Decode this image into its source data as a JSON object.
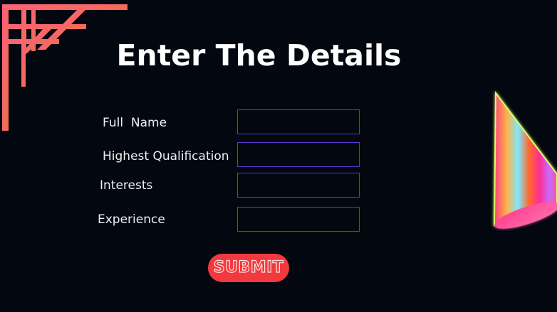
{
  "form": {
    "title": "Enter The Details",
    "fields": [
      {
        "label": "Full  Name",
        "value": ""
      },
      {
        "label": "Highest Qualification",
        "value": ""
      },
      {
        "label": "Interests",
        "value": ""
      },
      {
        "label": "Experience",
        "value": ""
      }
    ],
    "submit_label": "SUBMIT"
  },
  "colors": {
    "background": "#03070f",
    "input_border": "#6236d6",
    "submit_button": "#f1393f",
    "corner_decoration_from": "#ff5a78",
    "corner_decoration_to": "#f0744e"
  },
  "decorations": {
    "corner": "geometric-frame-decoration",
    "cone": "gradient-cone-decoration"
  }
}
